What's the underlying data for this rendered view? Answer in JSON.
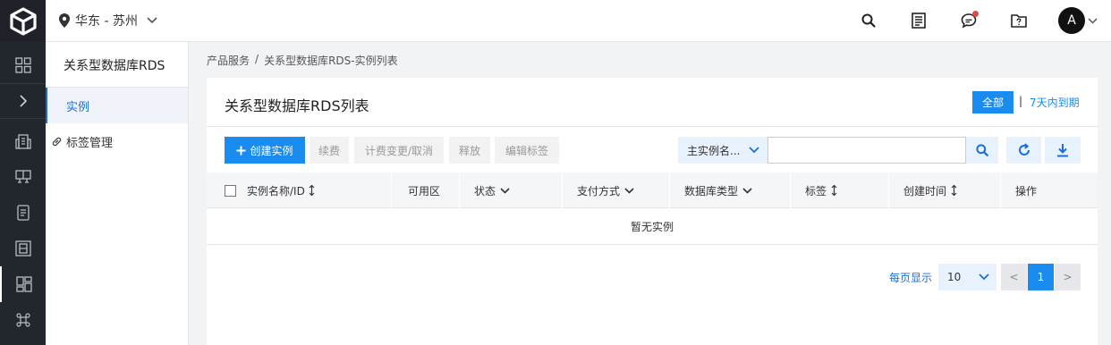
{
  "header": {
    "region": "华东 - 苏州",
    "avatar_letter": "A",
    "icons": [
      "search-icon",
      "document-icon",
      "message-icon",
      "folder-help-icon",
      "chevron-down-icon"
    ]
  },
  "rail": {
    "icons": [
      "grid-icon",
      "chevron-right-icon",
      "building-icon",
      "monitor-icon",
      "list-doc-icon",
      "server-icon",
      "dashboard-icon",
      "command-icon"
    ]
  },
  "product_sidebar": {
    "title": "关系型数据库RDS",
    "items": [
      {
        "label": "实例",
        "active": true
      },
      {
        "label": "标签管理",
        "active": false
      }
    ]
  },
  "breadcrumb": {
    "root": "产品服务",
    "sep": "/",
    "current": "关系型数据库RDS-实例列表"
  },
  "card": {
    "title": "关系型数据库RDS列表",
    "filter_all": "全部",
    "filter_sep": "|",
    "filter_7days": "7天内到期"
  },
  "toolbar": {
    "create": "创建实例",
    "renew": "续费",
    "billing_change": "计费变更/取消",
    "release": "释放",
    "edit_tags": "编辑标签",
    "search_field": "主实例名...",
    "search_value": ""
  },
  "table": {
    "columns": [
      "实例名称/ID",
      "可用区",
      "状态",
      "支付方式",
      "数据库类型",
      "标签",
      "创建时间",
      "操作"
    ],
    "empty_text": "暂无实例"
  },
  "pagination": {
    "label": "每页显示",
    "page_size": "10",
    "prev": "<",
    "current_page": "1",
    "next": ">"
  },
  "colors": {
    "primary": "#1a8cf0",
    "rail_bg": "#22262d",
    "badge_red": "#e54545"
  }
}
